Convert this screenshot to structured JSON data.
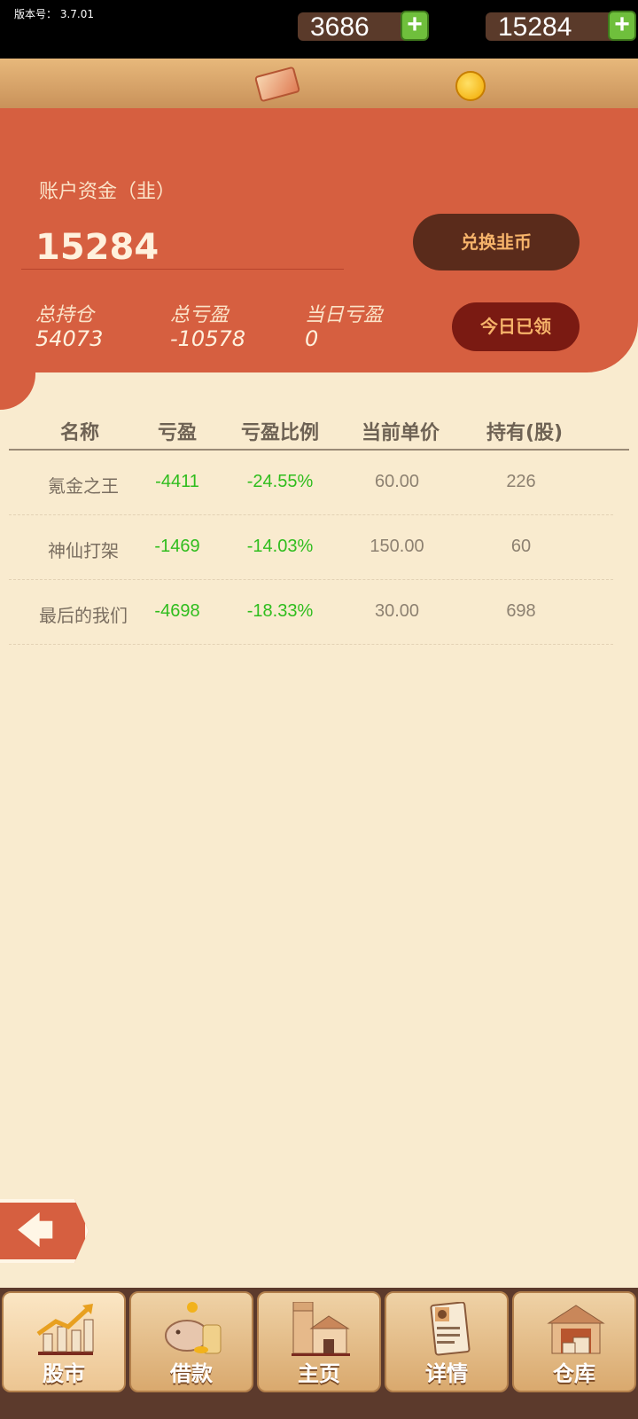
{
  "version": {
    "label": "版本号：",
    "value": "3.7.01"
  },
  "currencies": {
    "cash": "3686",
    "coins": "15284"
  },
  "account": {
    "label": "账户资金（韭）",
    "amount": "15284",
    "exchange_button": "兑换韭币",
    "claim_button": "今日已领",
    "stats": [
      {
        "label": "总持仓",
        "value": "54073"
      },
      {
        "label": "总亏盈",
        "value": "-10578"
      },
      {
        "label": "当日亏盈",
        "value": "0"
      }
    ]
  },
  "table": {
    "headers": [
      "名称",
      "亏盈",
      "亏盈比例",
      "当前单价",
      "持有(股)"
    ],
    "rows": [
      {
        "name": "氪金之王",
        "pl": "-4411",
        "ratio": "-24.55%",
        "price": "60.00",
        "held": "226"
      },
      {
        "name": "神仙打架",
        "pl": "-1469",
        "ratio": "-14.03%",
        "price": "150.00",
        "held": "60"
      },
      {
        "name": "最后的我们",
        "pl": "-4698",
        "ratio": "-18.33%",
        "price": "30.00",
        "held": "698"
      }
    ]
  },
  "nav": [
    {
      "label": "股市",
      "icon": "stock-chart-icon"
    },
    {
      "label": "借款",
      "icon": "piggy-bank-icon"
    },
    {
      "label": "主页",
      "icon": "house-icon"
    },
    {
      "label": "详情",
      "icon": "profile-card-icon"
    },
    {
      "label": "仓库",
      "icon": "warehouse-icon"
    }
  ],
  "colors": {
    "accent": "#d65f40",
    "profit_negative": "#2fbd1d",
    "background": "#f9ebcf"
  }
}
